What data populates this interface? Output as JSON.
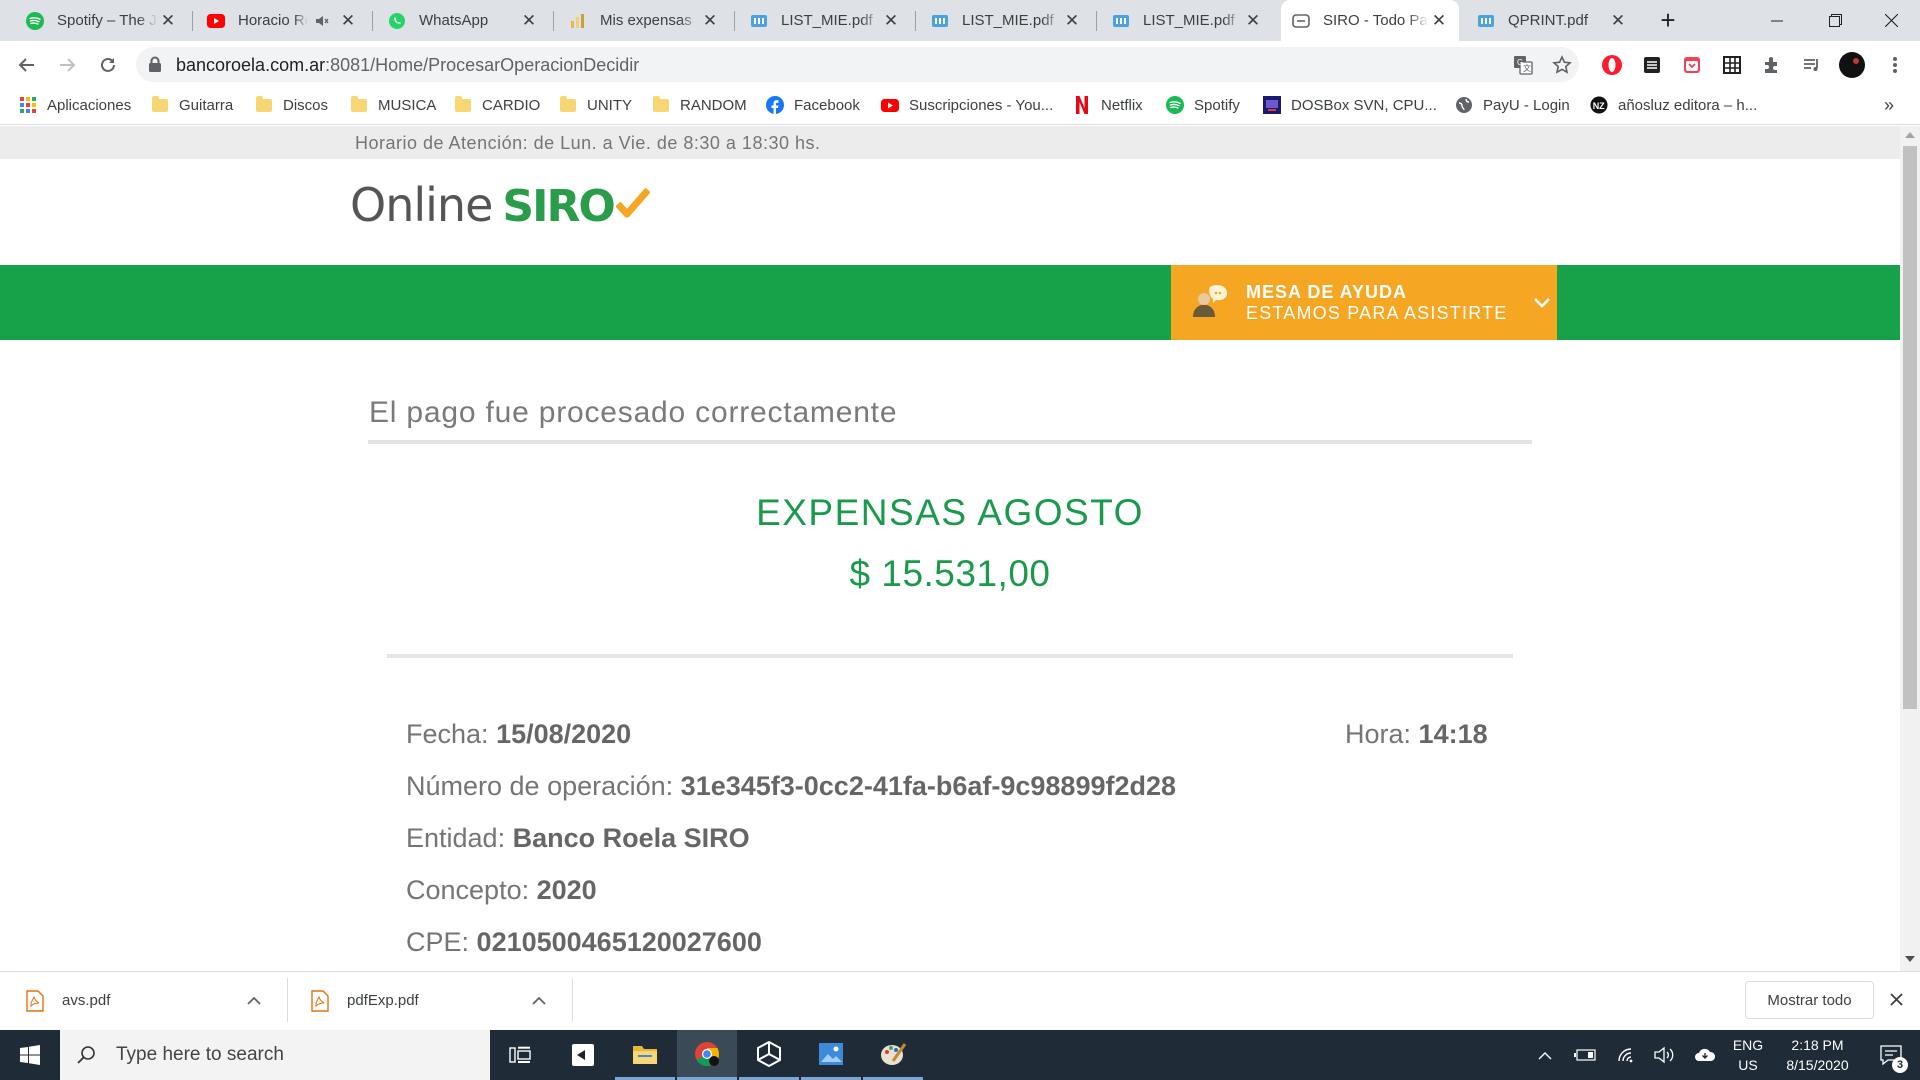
{
  "browser": {
    "tabs": [
      {
        "title": "Spotify – The Jo",
        "icon": "spotify-icon",
        "color": "#1db954"
      },
      {
        "title": "Horacio Ro",
        "icon": "youtube-icon",
        "color": "#ff0000",
        "muted": true
      },
      {
        "title": "WhatsApp",
        "icon": "whatsapp-icon",
        "color": "#25d366"
      },
      {
        "title": "Mis expensas",
        "icon": "chart-icon",
        "color": "#e6b84c"
      },
      {
        "title": "LIST_MIE.pdf",
        "icon": "pdf-icon",
        "color": "#4aa3df"
      },
      {
        "title": "LIST_MIE.pdf",
        "icon": "pdf-icon",
        "color": "#4aa3df"
      },
      {
        "title": "LIST_MIE.pdf",
        "icon": "pdf-icon",
        "color": "#4aa3df"
      },
      {
        "title": "SIRO - Todo Pa",
        "icon": "siro-icon",
        "color": "#5f6368",
        "active": true
      },
      {
        "title": "QPRINT.pdf",
        "icon": "pdf-icon",
        "color": "#4aa3df"
      }
    ],
    "url_host": "bancoroela.com.ar",
    "url_rest": ":8081/Home/ProcesarOperacionDecidir",
    "bookmarks": [
      {
        "label": "Aplicaciones",
        "icon": "apps-grid-icon"
      },
      {
        "label": "Guitarra",
        "icon": "folder-icon"
      },
      {
        "label": "Discos",
        "icon": "folder-icon"
      },
      {
        "label": "MUSICA",
        "icon": "folder-icon"
      },
      {
        "label": "CARDIO",
        "icon": "folder-icon"
      },
      {
        "label": "UNITY",
        "icon": "folder-icon"
      },
      {
        "label": "RANDOM",
        "icon": "folder-icon"
      },
      {
        "label": "Facebook",
        "icon": "facebook-icon"
      },
      {
        "label": "Suscripciones - You...",
        "icon": "youtube-icon"
      },
      {
        "label": "Netflix",
        "icon": "netflix-icon"
      },
      {
        "label": "Spotify",
        "icon": "spotify-icon"
      },
      {
        "label": "DOSBox SVN, CPU...",
        "icon": "dosbox-icon"
      },
      {
        "label": "PayU - Login",
        "icon": "globe-icon"
      },
      {
        "label": "añosluz editora – h...",
        "icon": "nz-icon"
      }
    ],
    "more_bookmarks": "»"
  },
  "page": {
    "hours": "Horario de Atención: de Lun. a Vie. de 8:30 a 18:30 hs.",
    "logo_online": "Online",
    "logo_siro": "SIRO",
    "help_title": "MESA DE AYUDA",
    "help_subtitle": "ESTAMOS PARA ASISTIRTE",
    "title": "El pago fue procesado correctamente",
    "concept": "EXPENSAS AGOSTO",
    "amount": "$ 15.531,00",
    "details": {
      "fecha_label": "Fecha:",
      "fecha": "15/08/2020",
      "hora_label": "Hora:",
      "hora": "14:18",
      "operacion_label": "Número de operación:",
      "operacion": "31e345f3-0cc2-41fa-b6af-9c98899f2d28",
      "entidad_label": "Entidad:",
      "entidad": "Banco Roela SIRO",
      "concepto_label": "Concepto:",
      "concepto": "2020",
      "cpe_label": "CPE:",
      "cpe": "0210500465120027600"
    },
    "colors": {
      "green": "#17a24a",
      "orange": "#f5a623"
    }
  },
  "downloads": {
    "items": [
      {
        "name": "avs.pdf"
      },
      {
        "name": "pdfExp.pdf"
      }
    ],
    "show_all": "Mostrar todo"
  },
  "taskbar": {
    "search_placeholder": "Type here to search",
    "lang_1": "ENG",
    "lang_2": "US",
    "time": "2:18 PM",
    "date": "8/15/2020",
    "notifications": "3"
  }
}
